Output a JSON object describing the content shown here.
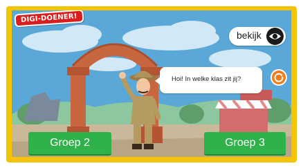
{
  "logo": {
    "text": "DIGI-DOENER!"
  },
  "view_button": {
    "label": "bekijk",
    "icon": "eye-icon"
  },
  "speech_bubble": {
    "text": "Hoi! In welke klas zit jij?"
  },
  "replay_button": {
    "icon": "replay-icon",
    "color": "#f07c1a"
  },
  "answers": [
    {
      "label": "Groep 2"
    },
    {
      "label": "Groep 3"
    }
  ],
  "colors": {
    "frame": "#f5c400",
    "answer_button": "#2fb24a",
    "logo_background": "#d81e1e"
  }
}
